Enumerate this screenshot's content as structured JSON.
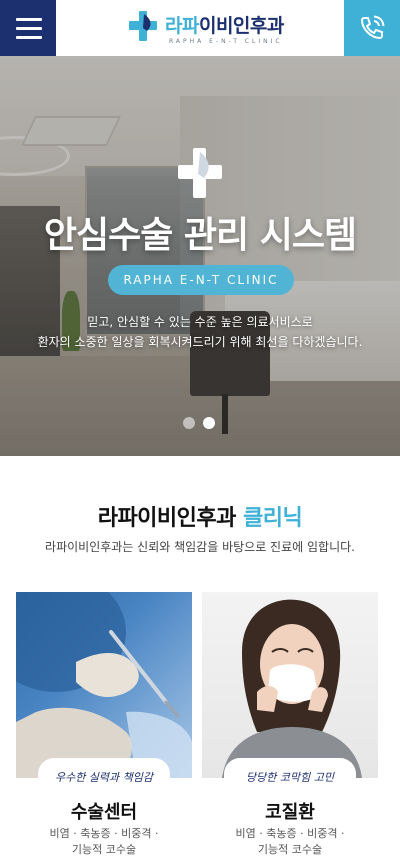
{
  "header": {
    "logo": {
      "text_accent": "라파",
      "text_main": "이비인후과",
      "subtitle": "RAPHA E-N-T CLINIC"
    },
    "menu_icon": "hamburger-menu-icon",
    "phone_icon": "phone-icon",
    "colors": {
      "menu_bg": "#1c2f6e",
      "phone_bg": "#3fb1d6"
    }
  },
  "hero": {
    "title": "안심수술 관리 시스템",
    "badge": "RAPHA E-N-T CLINIC",
    "desc_line1": "믿고, 안심할 수 있는 수준 높은 의료서비스로",
    "desc_line2": "환자의 소중한 일상을 회복시켜드리기 위해 최선을 다하겠습니다.",
    "slider": {
      "count": 2,
      "active": 2
    }
  },
  "clinic": {
    "title_main": "라파이비인후과",
    "title_accent": "클리닉",
    "desc": "라파이비인후과는 신뢰와 책임감을 바탕으로 진료에 임합니다.",
    "cards": [
      {
        "script": "우수한 실력과 책임감",
        "title": "수술센터",
        "sub_line1": "비염 · 축농증 · 비중격 ·",
        "sub_line2": "기능적 코수술"
      },
      {
        "script": "당당한 코막힘 고민",
        "title": "코질환",
        "sub_line1": "비염 · 축농증 · 비중격 ·",
        "sub_line2": "기능적 코수술"
      }
    ]
  }
}
